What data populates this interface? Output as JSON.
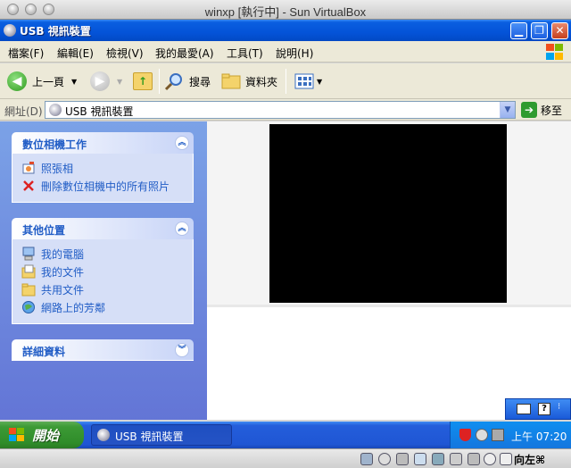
{
  "host_window": {
    "title": "winxp [執行中] - Sun VirtualBox"
  },
  "xp_window": {
    "title": "USB 視訊裝置",
    "caption_buttons": [
      "minimize",
      "maximize",
      "close"
    ]
  },
  "menubar": {
    "items": [
      "檔案(F)",
      "編輯(E)",
      "檢視(V)",
      "我的最愛(A)",
      "工具(T)",
      "說明(H)"
    ]
  },
  "toolbar": {
    "back_label": "上一頁",
    "search_label": "搜尋",
    "folders_label": "資料夾"
  },
  "addressbar": {
    "label": "網址(D)",
    "value": "USB 視訊裝置",
    "go_label": "移至"
  },
  "left_pane": {
    "camera_tasks": {
      "title": "數位相機工作",
      "items": [
        "照張相",
        "刪除數位相機中的所有照片"
      ]
    },
    "other_places": {
      "title": "其他位置",
      "items": [
        "我的電腦",
        "我的文件",
        "共用文件",
        "網路上的芳鄰"
      ]
    },
    "details": {
      "title": "詳細資料"
    }
  },
  "taskbar": {
    "start_label": "開始",
    "task_label": "USB 視訊裝置",
    "clock": "上午 07:20"
  },
  "vbox_status": {
    "host_key": "向左⌘"
  },
  "colors": {
    "xp_blue": "#0453d8",
    "task_link": "#215dc6",
    "start_green": "#3c9a35"
  }
}
